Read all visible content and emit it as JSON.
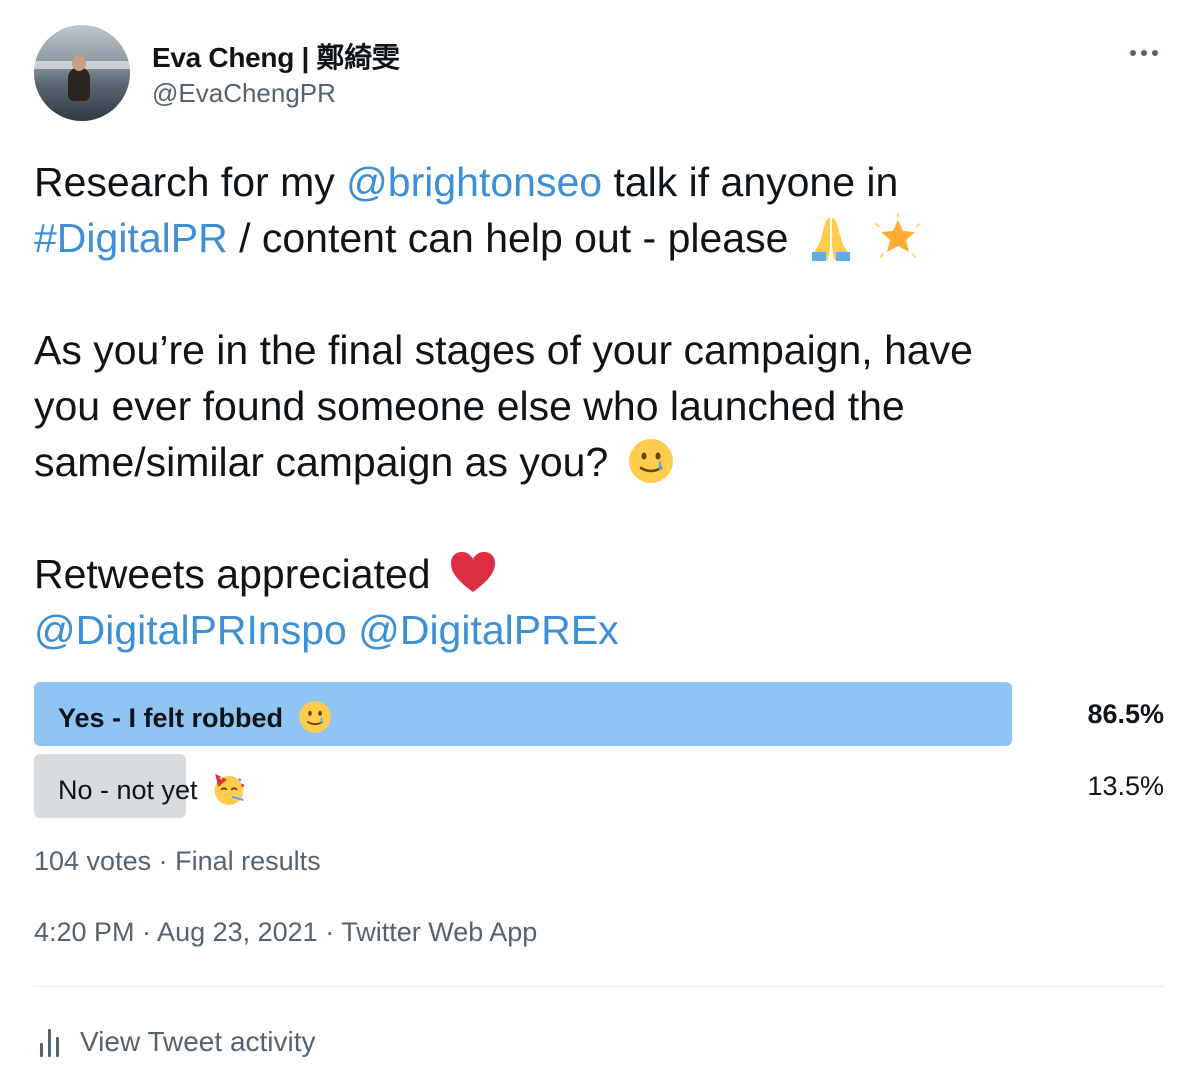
{
  "author": {
    "name": "Eva Cheng | 鄭綺雯",
    "handle": "@EvaChengPR"
  },
  "tweet": {
    "l1_pre": "Research for my ",
    "l1_link": "@brightonseo",
    "l1_post": " talk if anyone in",
    "l2_link": "#DigitalPR",
    "l2_post": " / content can help out - please",
    "l3": "As you’re in the final stages of your campaign, have",
    "l4": "you ever found someone else who launched the",
    "l5": "same/similar campaign as you?",
    "l6": "Retweets appreciated",
    "l7_link1": "@DigitalPRInspo",
    "l7_link2": "@DigitalPREx"
  },
  "poll": {
    "options": [
      {
        "label": "Yes - I felt robbed",
        "percent": "86.5%",
        "share": 86.5
      },
      {
        "label": "No - not yet",
        "percent": "13.5%",
        "share": 13.5
      }
    ],
    "summary": "104 votes · Final results"
  },
  "timestamp": "4:20 PM · Aug 23, 2021 · Twitter Web App",
  "activity_label": "View Tweet activity",
  "icons": [
    "more-icon",
    "folded-hands-emoji",
    "glowing-star-emoji",
    "tear-smile-emoji",
    "red-heart-emoji",
    "party-face-emoji",
    "analytics-icon"
  ],
  "colors": {
    "link": "#3d8fd6",
    "poll_winner": "#90c4f2",
    "poll_other": "#d8dcde",
    "muted": "#536471"
  }
}
